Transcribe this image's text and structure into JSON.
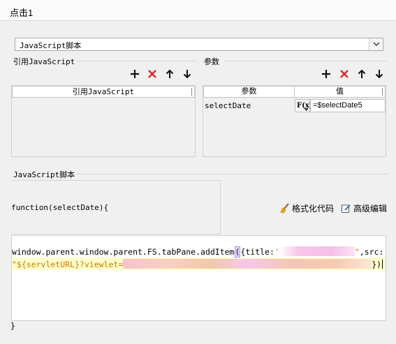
{
  "window": {
    "title": "点击1"
  },
  "script_type": {
    "selected": "JavaScript脚本"
  },
  "ref_section": {
    "label": "引用JavaScript",
    "column_header": "引用JavaScript",
    "rows": []
  },
  "param_section": {
    "label": "参数",
    "columns": [
      "参数",
      "值"
    ],
    "rows": [
      {
        "name": "selectDate",
        "formula_button": "F(x)",
        "value": "=$selectDate5"
      }
    ]
  },
  "toolbar_icons": [
    "add-icon",
    "delete-icon",
    "move-up-icon",
    "move-down-icon"
  ],
  "script_section": {
    "label": "JavaScript脚本",
    "function_signature": "function(selectDate){",
    "format_button": "格式化代码",
    "advanced_button": "高级编辑",
    "code_line1_prefix": "window.parent.window.parent.FS.tabPane.addItem",
    "code_line1_paren": "(",
    "code_line1_mid": "{title:",
    "code_line1_quote_open": "'",
    "code_line1_quote_close": "\"",
    "code_line1_suffix": ",src:",
    "code_line2_string": "\"${servletURL}?viewlet=",
    "code_line2_end": "})",
    "closing_brace": "}"
  },
  "colors": {
    "delete_red": "#e0252b",
    "string_orange": "#cc7a00",
    "highlight_line": "#ffffcc",
    "redaction_pink": "#f8c6ea",
    "redaction_peach": "#f7c9b0"
  }
}
